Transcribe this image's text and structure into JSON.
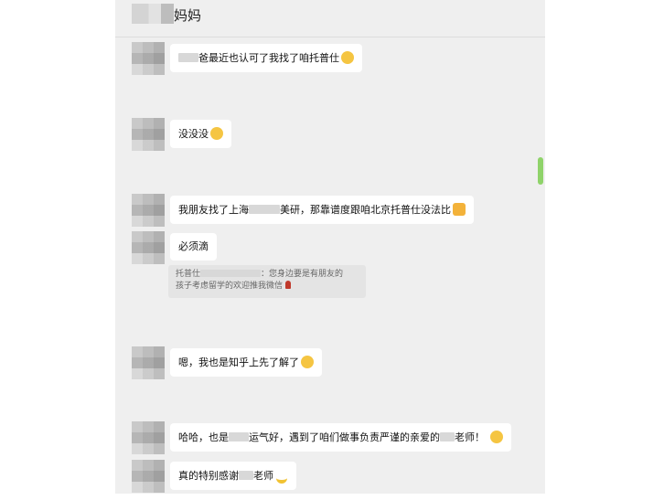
{
  "header": {
    "title": "妈妈"
  },
  "messages": [
    {
      "pre": "",
      "post": "爸最近也认可了我找了咱托普仕",
      "emoji": "smile"
    },
    {
      "text": "没没没",
      "emoji": "thinking"
    },
    {
      "pre": "我朋友找了上海",
      "post": "美研，那靠谱度跟咱北京托普仕没法比",
      "emoji": "cat"
    },
    {
      "text": "必须滴"
    },
    {
      "text": "嗯，我也是知乎上先了解了",
      "emoji": "grin"
    },
    {
      "pre": "哈哈，也是",
      "mid": "运气好，遇到了咱们做事负责严谨的亲爱的",
      "post": "老师！",
      "emoji": "smile"
    },
    {
      "pre": "真的特别感谢",
      "post": "老师",
      "emoji": "banana"
    }
  ],
  "quote": {
    "name": "托普仕",
    "line1": "：您身边要是有朋友的",
    "line2": "孩子考虑留学的欢迎推我微信"
  },
  "colors": {
    "chat_bg": "#efefef",
    "bubble": "#ffffff",
    "scroll_accent": "#8fd36a"
  }
}
